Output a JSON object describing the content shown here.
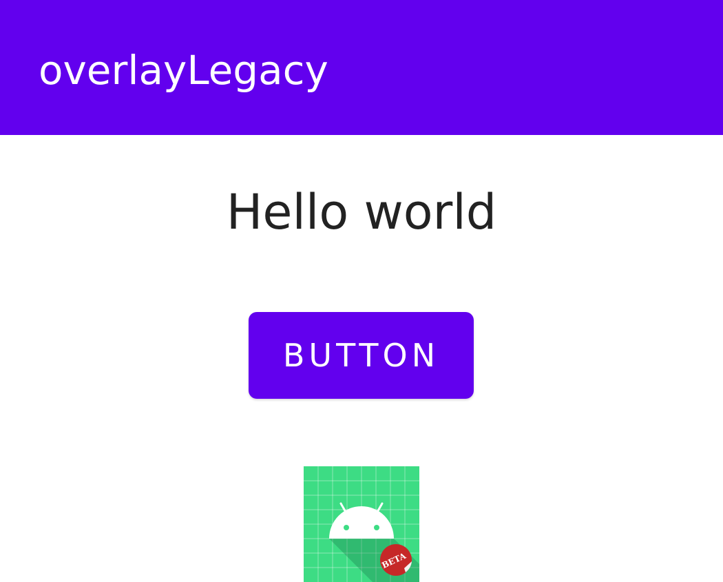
{
  "app_bar": {
    "title": "overlayLegacy",
    "color": "#6200EE"
  },
  "main": {
    "greeting": "Hello world",
    "button_label": "BUTTON",
    "button_color": "#6200EE"
  },
  "icon": {
    "name": "android-beta-icon",
    "badge_text": "BETA",
    "background_color": "#3DDC84",
    "badge_color": "#C62828"
  }
}
